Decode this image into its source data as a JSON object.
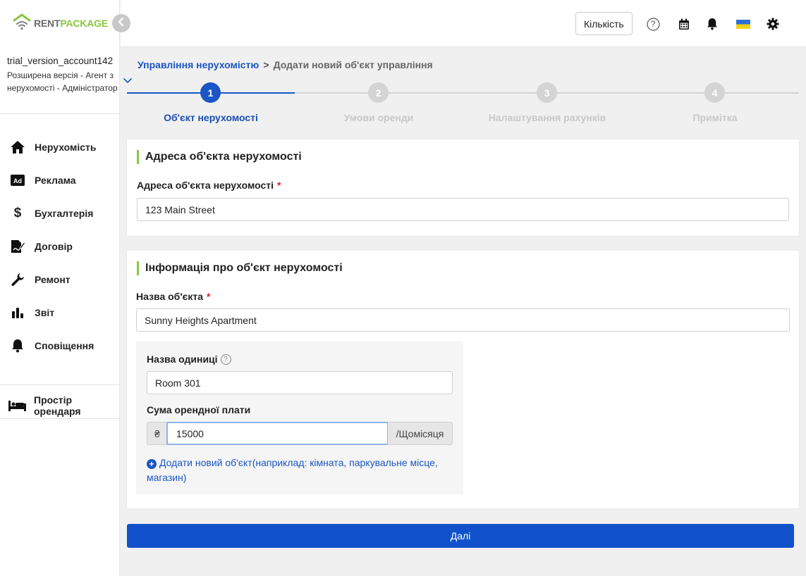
{
  "logo": {
    "part1": "RENT",
    "part2": "PACKAGE"
  },
  "account": {
    "name": "trial_version_account142",
    "role": "Розширена версія - Агент з нерухомості - Адміністратор"
  },
  "sidebar": {
    "items": [
      {
        "label": "Нерухомість",
        "icon": "home-icon"
      },
      {
        "label": "Реклама",
        "icon": "ad-icon"
      },
      {
        "label": "Бухгалтерія",
        "icon": "dollar-icon"
      },
      {
        "label": "Договір",
        "icon": "contract-icon"
      },
      {
        "label": "Ремонт",
        "icon": "wrench-icon"
      },
      {
        "label": "Звіт",
        "icon": "chart-icon"
      },
      {
        "label": "Сповіщення",
        "icon": "bell-icon"
      }
    ],
    "rent_space": "Простір орендаря"
  },
  "header": {
    "quantity_label": "Кількість",
    "help_glyph": "?"
  },
  "breadcrumb": {
    "link": "Управління нерухомістю",
    "separator": ">",
    "current": "Додати новий об'єкт управління"
  },
  "steps": [
    {
      "number": "1",
      "label": "Об'єкт нерухомості",
      "active": true
    },
    {
      "number": "2",
      "label": "Умови оренди",
      "active": false
    },
    {
      "number": "3",
      "label": "Налаштування рахунків",
      "active": false
    },
    {
      "number": "4",
      "label": "Примітка",
      "active": false
    }
  ],
  "address_card": {
    "title": "Адреса об'єкта нерухомості",
    "label": "Адреса об'єкта нерухомості",
    "required_mark": "*",
    "value": "123 Main Street"
  },
  "info_card": {
    "title": "Інформація про об'єкт нерухомості",
    "name_label": "Назва об'єкта",
    "required_mark": "*",
    "name_value": "Sunny Heights Apartment",
    "unit_label": "Назва одиниці",
    "unit_help": "?",
    "unit_value": "Room 301",
    "rent_label": "Сума орендної плати",
    "currency": "₴",
    "rent_value": "15000",
    "period": "/Щомісяця",
    "add_plus": "+",
    "add_link": "Додати новий об'єкт(наприклад: кімната, паркувальне місце, магазин)"
  },
  "next_label": "Далі",
  "colors": {
    "primary": "#1152cc",
    "accent_green": "#8cc63f",
    "required": "#d9232e"
  }
}
